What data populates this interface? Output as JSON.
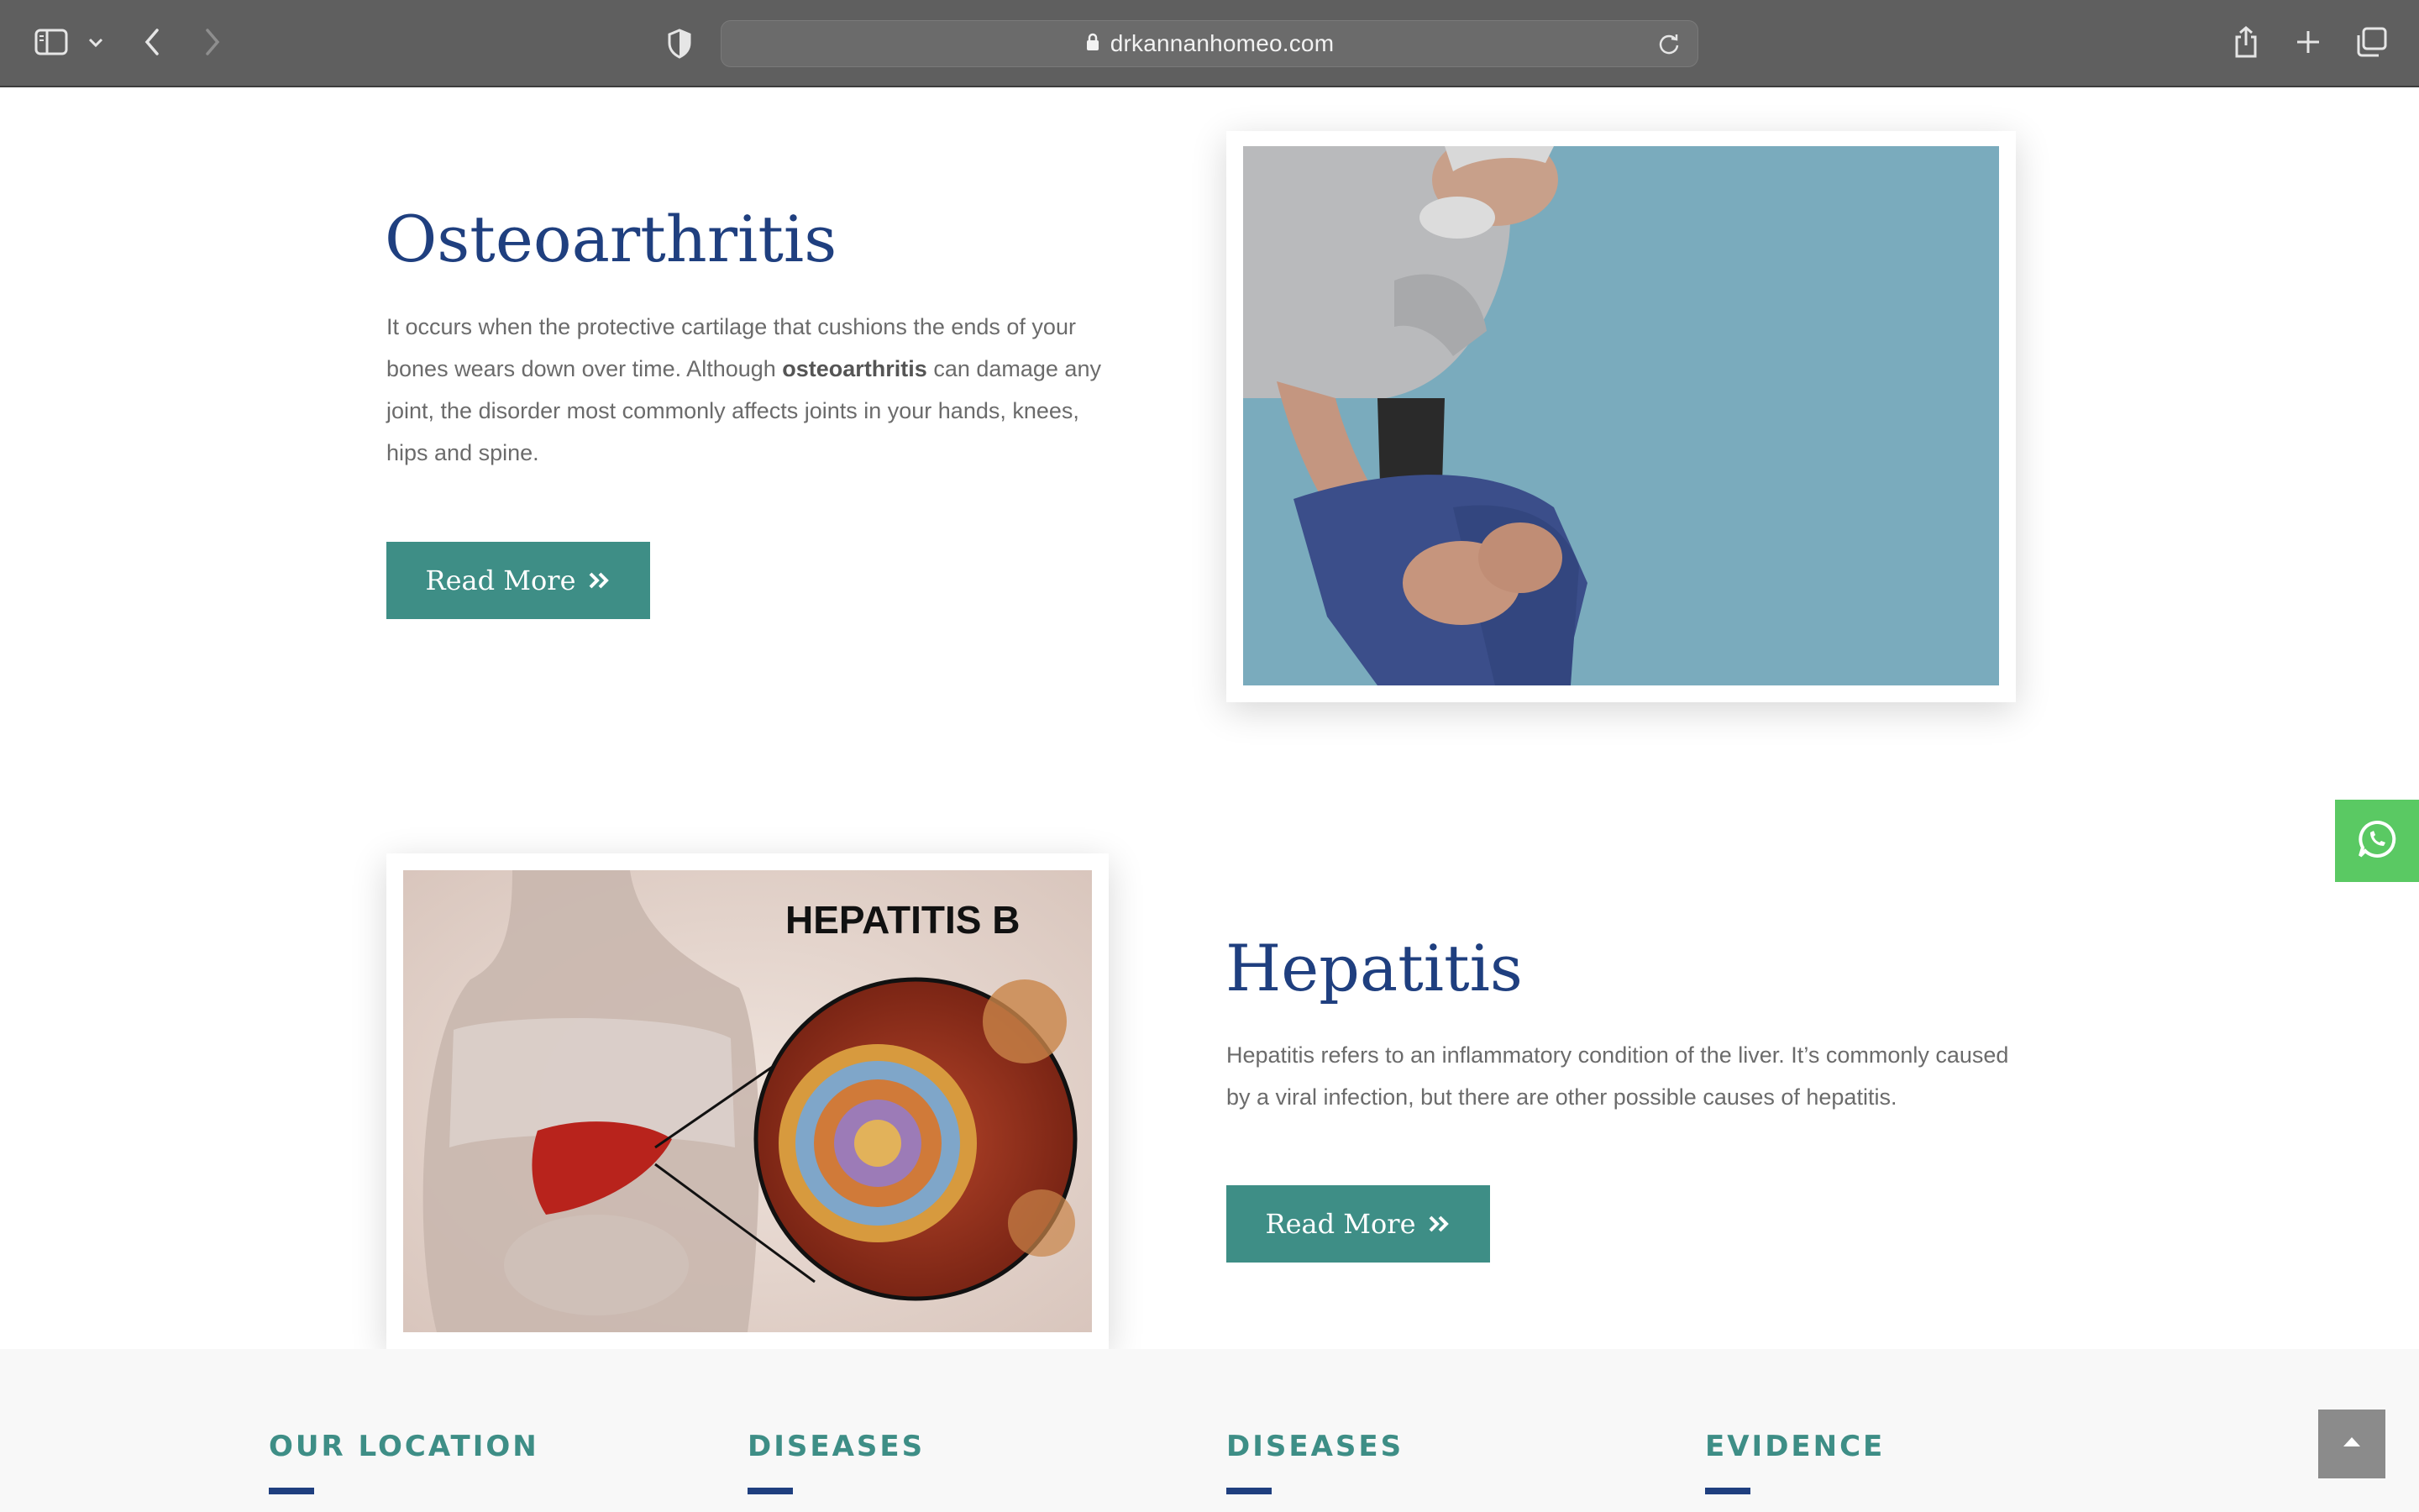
{
  "browser": {
    "url": "drkannanhomeo.com"
  },
  "sections": [
    {
      "title": "Osteoarthritis",
      "desc_before": " It occurs when the protective cartilage that cushions the ends of your bones wears down over time. Although ",
      "desc_bold": "osteoarthritis",
      "desc_after": " can damage any joint, the disorder most commonly affects joints in your hands, knees, hips and spine.",
      "button_label": "Read More"
    },
    {
      "title": "Hepatitis",
      "desc": "Hepatitis refers to an inflammatory condition of the liver. It’s commonly caused by a viral infection, but there are other possible causes of hepatitis.",
      "button_label": "Read More",
      "image_text": "HEPATITIS B"
    }
  ],
  "footer": {
    "columns": [
      "OUR LOCATION",
      "DISEASES",
      "DISEASES",
      "EVIDENCE"
    ]
  },
  "colors": {
    "heading": "#1f3f7f",
    "button": "#3e8e86",
    "whatsapp": "#5ac963",
    "footer_title": "#3e8e86"
  },
  "icons": [
    "sidebar-icon",
    "chevron-down-icon",
    "back-icon",
    "forward-icon",
    "privacy-shield-icon",
    "lock-icon",
    "reload-icon",
    "share-icon",
    "new-tab-icon",
    "tabs-overview-icon",
    "double-chevron-right-icon",
    "whatsapp-icon",
    "arrow-up-icon"
  ]
}
